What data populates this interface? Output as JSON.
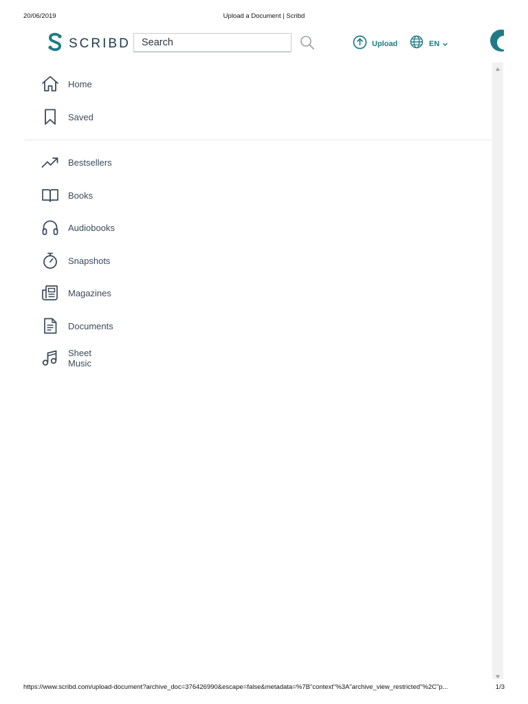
{
  "print_header": {
    "date": "20/06/2019",
    "title": "Upload a Document | Scribd"
  },
  "print_footer": {
    "url": "https://www.scribd.com/upload-document?archive_doc=376426990&escape=false&metadata=%7B\"context\"%3A\"archive_view_restricted\"%2C\"p...",
    "page": "1/3"
  },
  "header": {
    "logo_text": "SCRIBD",
    "search": {
      "placeholder": "Search",
      "value": ""
    },
    "upload_label": "Upload",
    "language_label": "EN"
  },
  "nav": {
    "primary": [
      {
        "label": "Home",
        "icon": "home-icon"
      },
      {
        "label": "Saved",
        "icon": "bookmark-icon"
      }
    ],
    "categories": [
      {
        "label": "Bestsellers",
        "icon": "trending-up-icon"
      },
      {
        "label": "Books",
        "icon": "open-book-icon"
      },
      {
        "label": "Audiobooks",
        "icon": "headphones-icon"
      },
      {
        "label": "Snapshots",
        "icon": "stopwatch-icon"
      },
      {
        "label": "Magazines",
        "icon": "newspaper-icon"
      },
      {
        "label": "Documents",
        "icon": "document-icon"
      },
      {
        "label": "Sheet Music",
        "icon": "music-note-icon"
      }
    ]
  },
  "colors": {
    "brand_teal": "#1e7b85",
    "nav_icon": "#3a4a5c",
    "logo_dark": "#1b3a4b"
  }
}
